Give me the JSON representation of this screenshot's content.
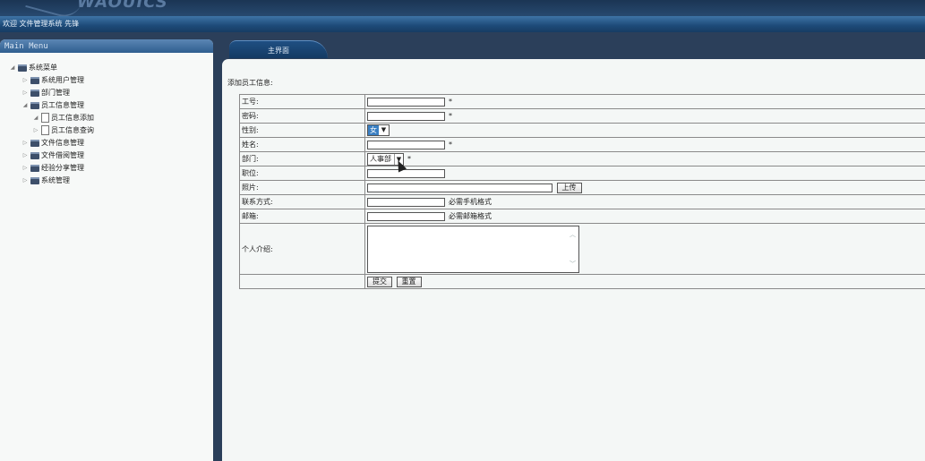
{
  "banner": {
    "logo_text": "WAOUICS"
  },
  "welcome_bar": {
    "text": "欢迎 文件管理系统 先锋"
  },
  "sidebar": {
    "title": "Main Menu",
    "items": [
      {
        "label": "系统菜单",
        "level": 0,
        "expanded": true,
        "type": "folder"
      },
      {
        "label": "系统用户管理",
        "level": 1,
        "expanded": false,
        "type": "folder"
      },
      {
        "label": "部门管理",
        "level": 1,
        "expanded": false,
        "type": "folder"
      },
      {
        "label": "员工信息管理",
        "level": 1,
        "expanded": true,
        "type": "folder"
      },
      {
        "label": "员工信息添加",
        "level": 2,
        "expanded": true,
        "type": "doc"
      },
      {
        "label": "员工信息查询",
        "level": 2,
        "expanded": false,
        "type": "doc"
      },
      {
        "label": "文件信息管理",
        "level": 1,
        "expanded": false,
        "type": "folder"
      },
      {
        "label": "文件借阅管理",
        "level": 1,
        "expanded": false,
        "type": "folder"
      },
      {
        "label": "经验分享管理",
        "level": 1,
        "expanded": false,
        "type": "folder"
      },
      {
        "label": "系统管理",
        "level": 1,
        "expanded": false,
        "type": "folder"
      }
    ]
  },
  "tab": {
    "label": "主界面"
  },
  "form": {
    "heading": "添加员工信息:",
    "rows": {
      "emp_id": {
        "label": "工号:",
        "value": "",
        "required": "*"
      },
      "password": {
        "label": "密码:",
        "value": "",
        "required": "*"
      },
      "gender": {
        "label": "性别:",
        "selected": "女"
      },
      "name": {
        "label": "姓名:",
        "value": "",
        "required": "*"
      },
      "department": {
        "label": "部门:",
        "selected": "人事部",
        "required": "*"
      },
      "position": {
        "label": "职位:",
        "value": ""
      },
      "photo": {
        "label": "照片:",
        "value": "",
        "button": "上传"
      },
      "contact": {
        "label": "联系方式:",
        "value": "",
        "note": "必需手机格式"
      },
      "email": {
        "label": "邮箱:",
        "value": "",
        "note": "必需邮箱格式"
      },
      "intro": {
        "label": "个人介绍:",
        "value": ""
      }
    },
    "submit_label": "提交",
    "reset_label": "重置"
  },
  "colors": {
    "header_dark": "#1b3554",
    "header_bar": "#2d5f93",
    "panel_bg": "#f4f7f6",
    "select_highlight": "#3a7fc2"
  }
}
